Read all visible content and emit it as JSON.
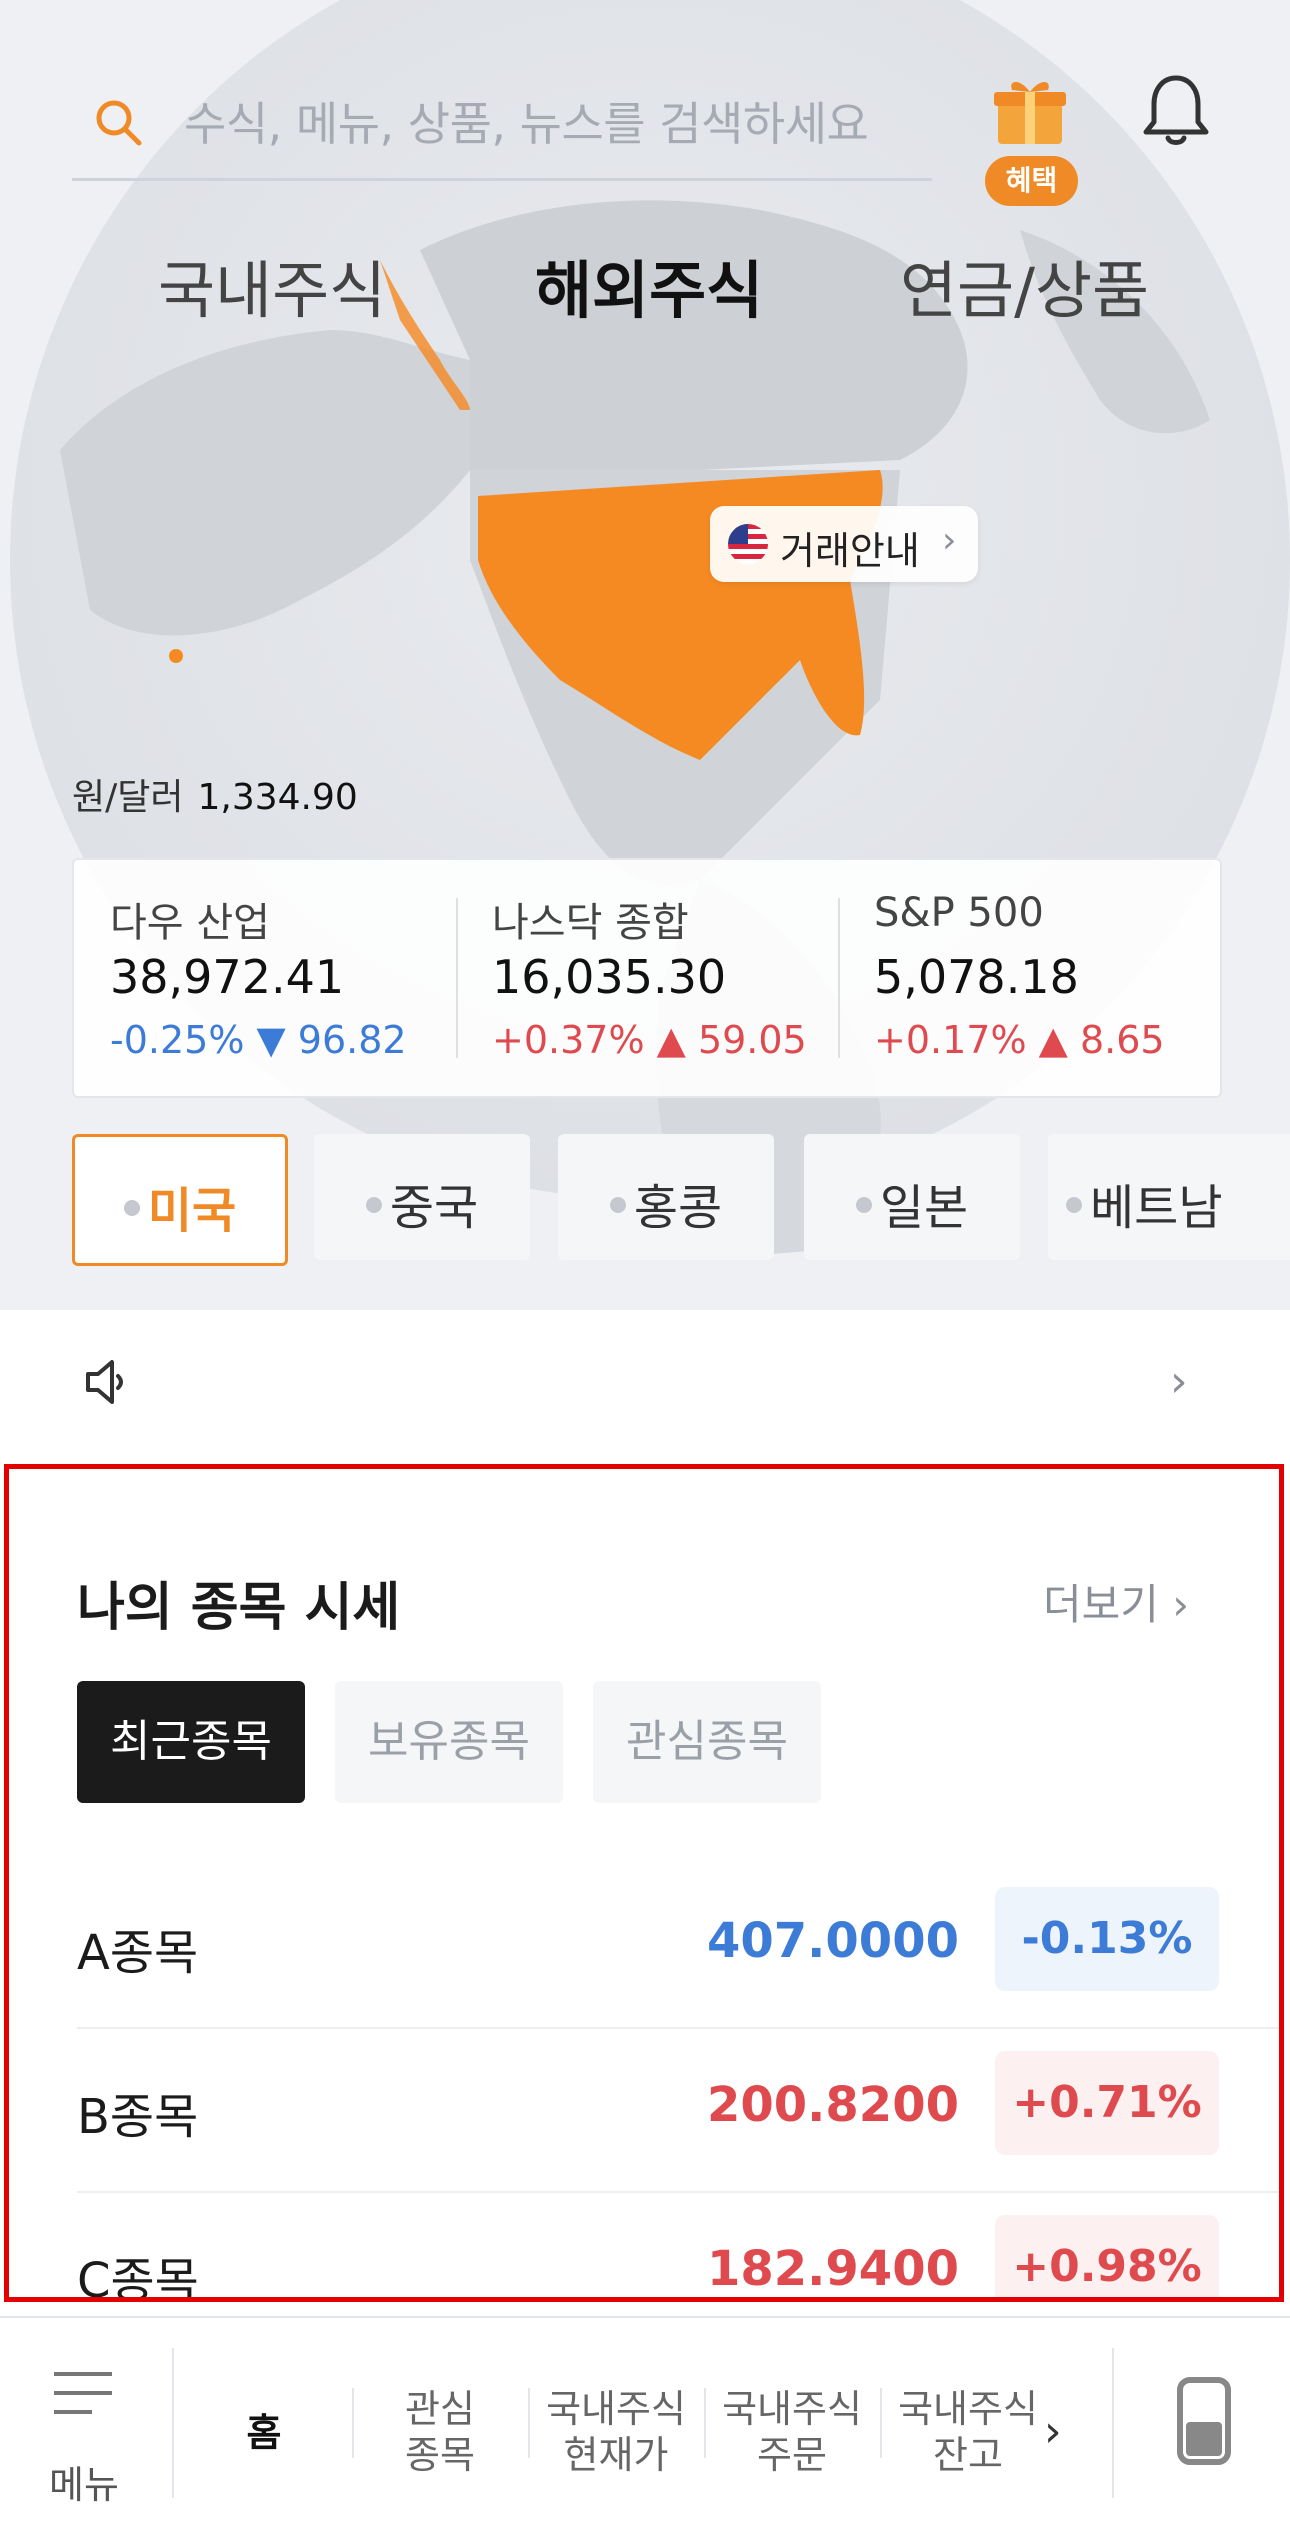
{
  "search": {
    "placeholder": "수식, 메뉴, 상품, 뉴스를 검색하세요"
  },
  "header": {
    "benefit_badge": "혜택"
  },
  "market_tabs": [
    {
      "label": "국내주식",
      "selected": false
    },
    {
      "label": "해외주식",
      "selected": true
    },
    {
      "label": "연금/상품",
      "selected": false
    }
  ],
  "guide": {
    "label": "거래안내",
    "chevron": "›"
  },
  "fx": {
    "label": "원/달러",
    "value": "1,334.90"
  },
  "indices": [
    {
      "name": "다우 산업",
      "value": "38,972.41",
      "change": "-0.25% ▼  96.82",
      "direction": "down"
    },
    {
      "name": "나스닥 종합",
      "value": "16,035.30",
      "change": "+0.37% ▲  59.05",
      "direction": "up"
    },
    {
      "name": "S&P 500",
      "value": "5,078.18",
      "change": "+0.17% ▲  8.65",
      "direction": "up"
    }
  ],
  "countries": [
    {
      "label": "미국",
      "selected": true
    },
    {
      "label": "중국",
      "selected": false
    },
    {
      "label": "홍콩",
      "selected": false
    },
    {
      "label": "일본",
      "selected": false
    },
    {
      "label": "베트남",
      "selected": false
    }
  ],
  "notice": {
    "chevron": "›"
  },
  "my_stocks": {
    "title": "나의 종목 시세",
    "more": "더보기 ›",
    "tabs": [
      {
        "label": "최근종목",
        "selected": true
      },
      {
        "label": "보유종목",
        "selected": false
      },
      {
        "label": "관심종목",
        "selected": false
      }
    ],
    "rows": [
      {
        "name": "A종목",
        "price": "407.0000",
        "change": "-0.13%",
        "direction": "down"
      },
      {
        "name": "B종목",
        "price": "200.8200",
        "change": "+0.71%",
        "direction": "up"
      },
      {
        "name": "C종목",
        "price": "182.9400",
        "change": "+0.98%",
        "direction": "up"
      }
    ]
  },
  "bottom_nav": {
    "menu": "메뉴",
    "items": [
      {
        "label": "홈"
      },
      {
        "label": "관심\n종목"
      },
      {
        "label": "국내주식\n현재가"
      },
      {
        "label": "국내주식\n주문"
      },
      {
        "label": "국내주식\n잔고"
      }
    ],
    "chevron": "›"
  },
  "colors": {
    "accent": "#f08a26",
    "up": "#df4a4f",
    "down": "#3c7bd6",
    "highlight_border": "#e30000"
  }
}
